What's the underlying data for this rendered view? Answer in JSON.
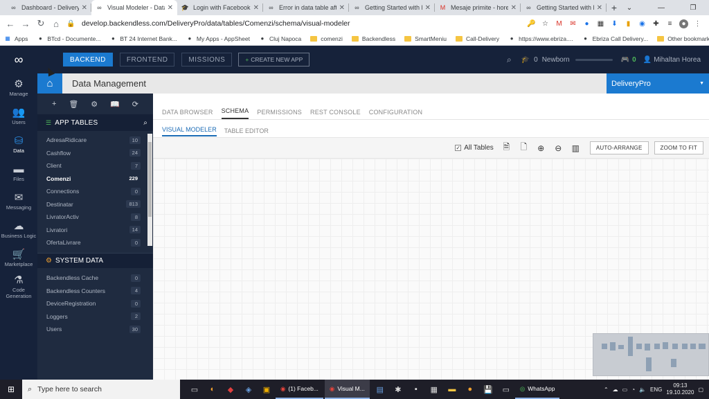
{
  "browser": {
    "tabs": [
      {
        "title": "Dashboard - DeliveryP",
        "icon": "backendless-icon",
        "active": false
      },
      {
        "title": "Visual Modeler - Data",
        "icon": "backendless-icon",
        "active": true
      },
      {
        "title": "Login with Facebook -",
        "icon": "graduation-cap-icon",
        "active": false
      },
      {
        "title": "Error in data table afte",
        "icon": "backendless-icon",
        "active": false
      },
      {
        "title": "Getting Started with Ba",
        "icon": "backendless-icon",
        "active": false
      },
      {
        "title": "Mesaje primite - horea",
        "icon": "gmail-icon",
        "active": false
      },
      {
        "title": "Getting Started with Ba",
        "icon": "backendless-icon",
        "active": false
      }
    ],
    "url": "develop.backendless.com/DeliveryPro/data/tables/Comenzi/schema/visual-modeler",
    "bookmarks": [
      "Apps",
      "BTcd - Documente...",
      "BT 24 Internet Bank...",
      "My Apps - AppSheet",
      "Cluj Napoca",
      "comenzi",
      "Backendless",
      "SmartMeniu",
      "Call-Delivery",
      "https://www.ebriza....",
      "Ebriza Call Delivery..."
    ],
    "other_bookmarks": "Other bookmarks"
  },
  "header": {
    "nav": [
      "BACKEND",
      "FRONTEND",
      "MISSIONS"
    ],
    "create_app": "CREATE NEW APP",
    "level_count": "0",
    "rank": "Newborn",
    "points": "0",
    "user": "Mihaltan Horea"
  },
  "sidenav": [
    {
      "label": "Manage",
      "icon": "gear-icon",
      "glyph": "⚙"
    },
    {
      "label": "Users",
      "icon": "users-icon",
      "glyph": "👥"
    },
    {
      "label": "Data",
      "icon": "database-icon",
      "glyph": "⛁"
    },
    {
      "label": "Files",
      "icon": "folder-icon",
      "glyph": "▬"
    },
    {
      "label": "Messaging",
      "icon": "envelope-icon",
      "glyph": "✉"
    },
    {
      "label": "Business Logic",
      "icon": "cloud-code-icon",
      "glyph": "☁"
    },
    {
      "label": "Marketplace",
      "icon": "cart-icon",
      "glyph": "🛒"
    },
    {
      "label": "Code Generation",
      "icon": "flask-icon",
      "glyph": "⚗"
    }
  ],
  "page": {
    "title": "Data Management",
    "app_name": "DeliveryPro"
  },
  "tables": {
    "heading": "APP TABLES",
    "items": [
      {
        "name": "AdresaRidicare",
        "count": "10"
      },
      {
        "name": "Cashflow",
        "count": "24"
      },
      {
        "name": "Client",
        "count": "7"
      },
      {
        "name": "Comenzi",
        "count": "229",
        "selected": true
      },
      {
        "name": "Connections",
        "count": "0"
      },
      {
        "name": "Destinatar",
        "count": "813"
      },
      {
        "name": "LivratorActiv",
        "count": "8"
      },
      {
        "name": "Livratori",
        "count": "14"
      },
      {
        "name": "OfertaLivrare",
        "count": "0"
      }
    ]
  },
  "system": {
    "heading": "SYSTEM DATA",
    "items": [
      {
        "name": "Backendless Cache",
        "count": "0"
      },
      {
        "name": "Backendless Counters",
        "count": "4"
      },
      {
        "name": "DeviceRegistration",
        "count": "0"
      },
      {
        "name": "Loggers",
        "count": "2"
      },
      {
        "name": "Users",
        "count": "30"
      }
    ]
  },
  "main": {
    "tabs": [
      "DATA BROWSER",
      "SCHEMA",
      "PERMISSIONS",
      "REST CONSOLE",
      "CONFIGURATION"
    ],
    "subtabs": [
      "VISUAL MODELER",
      "TABLE EDITOR"
    ],
    "all_tables_label": "All Tables",
    "auto_arrange": "AUTO-ARRANGE",
    "zoom_to_fit": "ZOOM TO FIT"
  },
  "taskbar": {
    "search_placeholder": "Type here to search",
    "tasks": [
      "(1) Faceb...",
      "Visual M...",
      "WhatsApp"
    ],
    "language": "ENG",
    "time": "09:13",
    "date": "19.10.2020"
  }
}
